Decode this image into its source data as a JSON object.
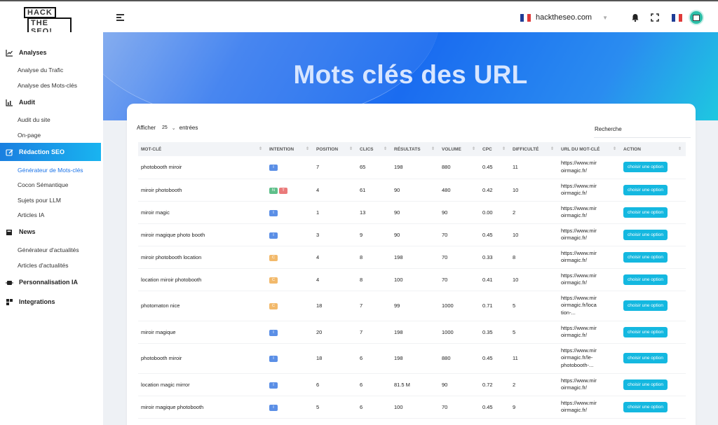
{
  "logo": {
    "line1": "HACK",
    "line2": "THE SEO!"
  },
  "header": {
    "site_name": "hackthe­seo.com"
  },
  "colors": {
    "accent": "#1a7fe0",
    "button": "#14b8e0",
    "flag_blue": "#1f3c96",
    "flag_red": "#e03a3a"
  },
  "sidebar": {
    "sections": [
      {
        "label": "Analyses",
        "icon": "line-chart-icon"
      },
      {
        "label": "Audit",
        "icon": "bar-chart-icon"
      },
      {
        "label": "Rédaction SEO",
        "icon": "edit-icon"
      },
      {
        "label": "News",
        "icon": "newspaper-icon"
      },
      {
        "label": "Personnalisation IA",
        "icon": "robot-icon"
      },
      {
        "label": "Integrations",
        "icon": "puzzle-icon"
      }
    ],
    "items": [
      "Analyse du Trafic",
      "Analyse des Mots-clés",
      "Audit du site",
      "On-page",
      "Générateur de Mots-clés",
      "Cocon Sémantique",
      "Sujets pour LLM",
      "Articles IA",
      "Générateur d'actualités",
      "Articles d'actualités"
    ]
  },
  "page": {
    "title": "Mots clés des URL"
  },
  "table_controls": {
    "show_label": "Afficher",
    "page_size": "25",
    "entries_label": "entrées",
    "search_placeholder": "Recherche"
  },
  "table": {
    "headers": [
      "MOT-CLÉ",
      "INTENTION",
      "POSITION",
      "CLICS",
      "RÉSULTATS",
      "VOLUME",
      "CPC",
      "DIFFICULTÉ",
      "URL DU MOT-CLÉ",
      "ACTION"
    ],
    "action_label": "choisir une option",
    "rows": [
      {
        "keyword": "photobooth miroir",
        "intents": [
          "I"
        ],
        "position": "7",
        "clicks": "65",
        "results": "198",
        "volume": "880",
        "cpc": "0.45",
        "difficulty": "11",
        "url1": "https://www.mir",
        "url2": "oirmagic.fr/",
        "url3": ""
      },
      {
        "keyword": "miroir photobooth",
        "intents": [
          "N",
          "T"
        ],
        "position": "4",
        "clicks": "61",
        "results": "90",
        "volume": "480",
        "cpc": "0.42",
        "difficulty": "10",
        "url1": "https://www.mir",
        "url2": "oirmagic.fr/",
        "url3": ""
      },
      {
        "keyword": "miroir magic",
        "intents": [
          "I"
        ],
        "position": "1",
        "clicks": "13",
        "results": "90",
        "volume": "90",
        "cpc": "0.00",
        "difficulty": "2",
        "url1": "https://www.mir",
        "url2": "oirmagic.fr/",
        "url3": ""
      },
      {
        "keyword": "miroir magique photo booth",
        "intents": [
          "I"
        ],
        "position": "3",
        "clicks": "9",
        "results": "90",
        "volume": "70",
        "cpc": "0.45",
        "difficulty": "10",
        "url1": "https://www.mir",
        "url2": "oirmagic.fr/",
        "url3": ""
      },
      {
        "keyword": "miroir photobooth location",
        "intents": [
          "C"
        ],
        "position": "4",
        "clicks": "8",
        "results": "198",
        "volume": "70",
        "cpc": "0.33",
        "difficulty": "8",
        "url1": "https://www.mir",
        "url2": "oirmagic.fr/",
        "url3": ""
      },
      {
        "keyword": "location miroir photobooth",
        "intents": [
          "C"
        ],
        "position": "4",
        "clicks": "8",
        "results": "100",
        "volume": "70",
        "cpc": "0.41",
        "difficulty": "10",
        "url1": "https://www.mir",
        "url2": "oirmagic.fr/",
        "url3": ""
      },
      {
        "keyword": "photomaton nice",
        "intents": [
          "C"
        ],
        "position": "18",
        "clicks": "7",
        "results": "99",
        "volume": "1000",
        "cpc": "0.71",
        "difficulty": "5",
        "url1": "https://www.mir",
        "url2": "oirmagic.fr/loca",
        "url3": "tion-..."
      },
      {
        "keyword": "miroir magique",
        "intents": [
          "I"
        ],
        "position": "20",
        "clicks": "7",
        "results": "198",
        "volume": "1000",
        "cpc": "0.35",
        "difficulty": "5",
        "url1": "https://www.mir",
        "url2": "oirmagic.fr/",
        "url3": ""
      },
      {
        "keyword": "photobooth miroir",
        "intents": [
          "I"
        ],
        "position": "18",
        "clicks": "6",
        "results": "198",
        "volume": "880",
        "cpc": "0.45",
        "difficulty": "11",
        "url1": "https://www.mir",
        "url2": "oirmagic.fr/le-",
        "url3": "photobooth-..."
      },
      {
        "keyword": "location magic mirror",
        "intents": [
          "I"
        ],
        "position": "6",
        "clicks": "6",
        "results": "81.5 M",
        "volume": "90",
        "cpc": "0.72",
        "difficulty": "2",
        "url1": "https://www.mir",
        "url2": "oirmagic.fr/",
        "url3": ""
      },
      {
        "keyword": "miroir magique photobooth",
        "intents": [
          "I"
        ],
        "position": "5",
        "clicks": "6",
        "results": "100",
        "volume": "70",
        "cpc": "0.45",
        "difficulty": "9",
        "url1": "https://www.mir",
        "url2": "oirmagic.fr/",
        "url3": ""
      }
    ]
  }
}
